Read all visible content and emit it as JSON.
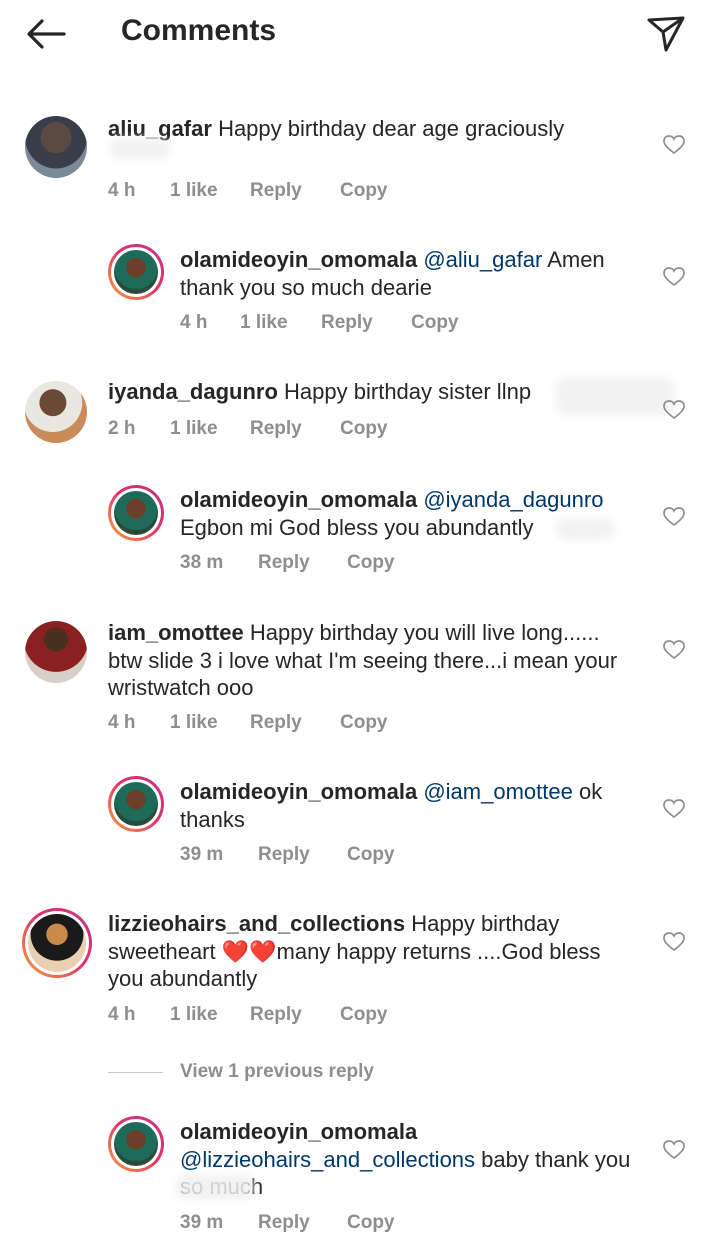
{
  "header": {
    "title": "Comments",
    "back_icon": "arrow-left-icon",
    "share_icon": "paper-plane-icon"
  },
  "comments": [
    {
      "username": "aliu_gafar",
      "text": "Happy birthday dear age graciously",
      "time": "4 h",
      "likes": "1 like",
      "reply": "Reply",
      "copy": "Copy"
    },
    {
      "username": "olamideoyin_omomala",
      "mention": "@aliu_gafar",
      "text": "Amen thank you so much dearie",
      "time": "4 h",
      "likes": "1 like",
      "reply": "Reply",
      "copy": "Copy"
    },
    {
      "username": "iyanda_dagunro",
      "text": "Happy birthday sister llnp",
      "time": "2 h",
      "likes": "1 like",
      "reply": "Reply",
      "copy": "Copy"
    },
    {
      "username": "olamideoyin_omomala",
      "mention": "@iyanda_dagunro",
      "text": "Egbon mi God bless you abundantly",
      "time": "38 m",
      "reply": "Reply",
      "copy": "Copy"
    },
    {
      "username": "iam_omottee",
      "text": "Happy birthday you will live long...... btw slide 3 i love what I'm seeing there...i mean your wristwatch ooo",
      "time": "4 h",
      "likes": "1 like",
      "reply": "Reply",
      "copy": "Copy"
    },
    {
      "username": "olamideoyin_omomala",
      "mention": "@iam_omottee",
      "text": "ok thanks",
      "time": "39 m",
      "reply": "Reply",
      "copy": "Copy"
    },
    {
      "username": "lizzieohairs_and_collections",
      "text": "Happy birthday sweetheart ❤️❤️many happy returns ....God bless you abundantly",
      "time": "4 h",
      "likes": "1 like",
      "reply": "Reply",
      "copy": "Copy"
    },
    {
      "username": "olamideoyin_omomala",
      "mention": "@lizzieohairs_and_collections",
      "text": "baby thank you so much",
      "time": "39 m",
      "reply": "Reply",
      "copy": "Copy"
    }
  ],
  "view_previous": "View 1 previous reply",
  "colors": {
    "mention": "#00376b",
    "meta": "#8e8e8e",
    "ring_start": "#f9a13a",
    "ring_end": "#c13584"
  }
}
